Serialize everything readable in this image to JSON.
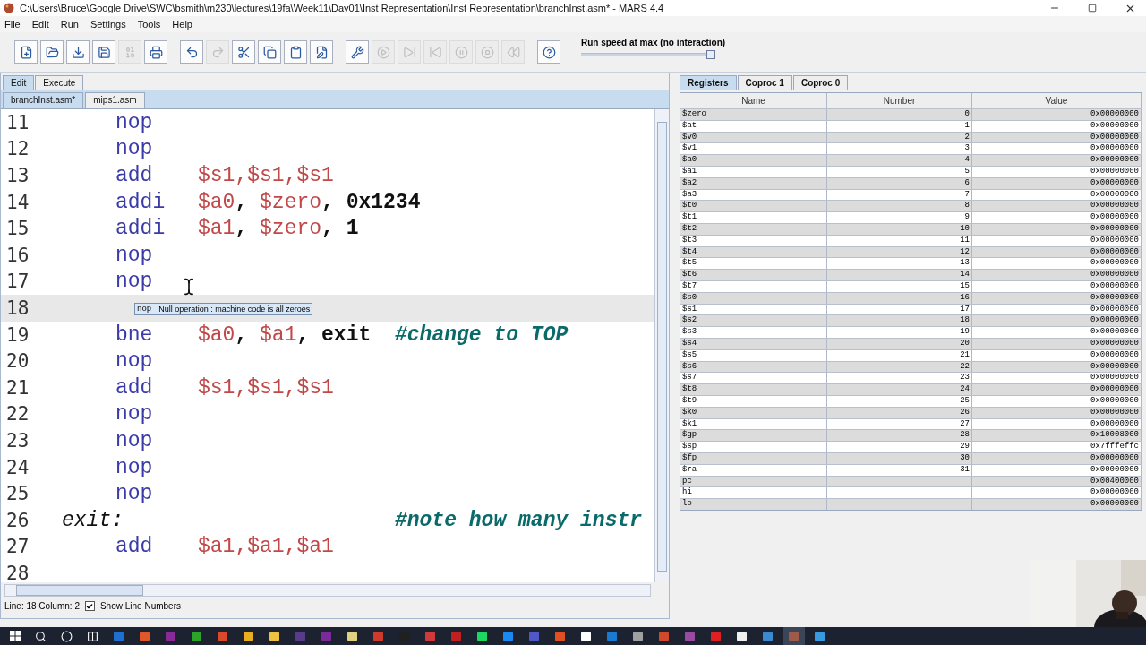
{
  "window": {
    "title": "C:\\Users\\Bruce\\Google Drive\\SWC\\bsmith\\m230\\lectures\\19fa\\Week11\\Day01\\Inst Representation\\Inst Representation\\branchInst.asm* - MARS 4.4"
  },
  "menu": [
    "File",
    "Edit",
    "Run",
    "Settings",
    "Tools",
    "Help"
  ],
  "toolbar": [
    {
      "kind": "new",
      "disabled": false
    },
    {
      "kind": "open",
      "disabled": false
    },
    {
      "kind": "save",
      "disabled": false
    },
    {
      "kind": "saveas",
      "disabled": false
    },
    {
      "kind": "dump",
      "disabled": true
    },
    {
      "kind": "print",
      "disabled": false
    },
    {
      "kind": "sep"
    },
    {
      "kind": "undo",
      "disabled": false
    },
    {
      "kind": "redo",
      "disabled": true
    },
    {
      "kind": "cut",
      "disabled": false
    },
    {
      "kind": "copy",
      "disabled": false
    },
    {
      "kind": "paste",
      "disabled": false
    },
    {
      "kind": "find",
      "disabled": false
    },
    {
      "kind": "sep"
    },
    {
      "kind": "assemble",
      "disabled": false
    },
    {
      "kind": "run",
      "disabled": true
    },
    {
      "kind": "step",
      "disabled": true
    },
    {
      "kind": "back",
      "disabled": true
    },
    {
      "kind": "pause",
      "disabled": true
    },
    {
      "kind": "stop",
      "disabled": true
    },
    {
      "kind": "reset",
      "disabled": true
    },
    {
      "kind": "sep"
    },
    {
      "kind": "help",
      "disabled": false
    }
  ],
  "speed": {
    "label": "Run speed at max (no interaction)",
    "level": 1
  },
  "mode_tabs": [
    {
      "label": "Edit",
      "selected": true
    },
    {
      "label": "Execute",
      "selected": false
    }
  ],
  "file_tabs": [
    {
      "label": "branchInst.asm*",
      "selected": true
    },
    {
      "label": "mips1.asm",
      "selected": false
    }
  ],
  "editor": {
    "lines": [
      {
        "number": "11",
        "op": "nop",
        "current": false
      },
      {
        "number": "12",
        "op": "nop",
        "current": false
      },
      {
        "number": "13",
        "op": "add",
        "args": [
          {
            "kind": "reg",
            "text": "$s1,$s1,$s1"
          }
        ],
        "current": false
      },
      {
        "number": "14",
        "op": "addi",
        "args": [
          {
            "kind": "reg",
            "text": "$a0"
          },
          {
            "kind": "punct",
            "text": ", "
          },
          {
            "kind": "reg",
            "text": "$zero"
          },
          {
            "kind": "punct",
            "text": ", "
          },
          {
            "kind": "imm",
            "text": "0x1234"
          }
        ],
        "current": false
      },
      {
        "number": "15",
        "op": "addi",
        "args": [
          {
            "kind": "reg",
            "text": "$a1"
          },
          {
            "kind": "punct",
            "text": ", "
          },
          {
            "kind": "reg",
            "text": "$zero"
          },
          {
            "kind": "punct",
            "text": ", "
          },
          {
            "kind": "imm",
            "text": "1"
          }
        ],
        "current": false
      },
      {
        "number": "16",
        "op": "nop",
        "current": false
      },
      {
        "number": "17",
        "op": "nop",
        "current": false
      },
      {
        "number": "18",
        "current": true
      },
      {
        "number": "19",
        "op": "bne",
        "args": [
          {
            "kind": "reg",
            "text": "$a0"
          },
          {
            "kind": "punct",
            "text": ", "
          },
          {
            "kind": "reg",
            "text": "$a1"
          },
          {
            "kind": "punct",
            "text": ", "
          },
          {
            "kind": "imm",
            "text": "exit"
          }
        ],
        "comment": "#change to TOP",
        "current": false
      },
      {
        "number": "20",
        "op": "nop",
        "current": false
      },
      {
        "number": "21",
        "op": "add",
        "args": [
          {
            "kind": "reg",
            "text": "$s1,$s1,$s1"
          }
        ],
        "current": false
      },
      {
        "number": "22",
        "op": "nop",
        "current": false
      },
      {
        "number": "23",
        "op": "nop",
        "current": false
      },
      {
        "number": "24",
        "op": "nop",
        "current": false
      },
      {
        "number": "25",
        "op": "nop",
        "current": false
      },
      {
        "number": "26",
        "label": "exit:",
        "comment": "#note how many instr",
        "current": false
      },
      {
        "number": "27",
        "op": "add",
        "args": [
          {
            "kind": "reg",
            "text": "$a1,$a1,$a1"
          }
        ],
        "current": false
      },
      {
        "number": "28",
        "current": false
      }
    ],
    "tooltip": {
      "mnemonic": "nop",
      "description": "Null operation : machine code is all zeroes"
    }
  },
  "status": {
    "position": "Line: 18 Column: 2",
    "show_line_numbers": {
      "label": "Show Line Numbers",
      "checked": true
    }
  },
  "register_tabs": [
    {
      "label": "Registers",
      "selected": true
    },
    {
      "label": "Coproc 1",
      "selected": false
    },
    {
      "label": "Coproc 0",
      "selected": false
    }
  ],
  "registers": {
    "columns": [
      "Name",
      "Number",
      "Value"
    ],
    "rows": [
      {
        "name": "$zero",
        "number": "0",
        "value": "0x00000000"
      },
      {
        "name": "$at",
        "number": "1",
        "value": "0x00000000"
      },
      {
        "name": "$v0",
        "number": "2",
        "value": "0x00000000"
      },
      {
        "name": "$v1",
        "number": "3",
        "value": "0x00000000"
      },
      {
        "name": "$a0",
        "number": "4",
        "value": "0x00000000"
      },
      {
        "name": "$a1",
        "number": "5",
        "value": "0x00000000"
      },
      {
        "name": "$a2",
        "number": "6",
        "value": "0x00000000"
      },
      {
        "name": "$a3",
        "number": "7",
        "value": "0x00000000"
      },
      {
        "name": "$t0",
        "number": "8",
        "value": "0x00000000"
      },
      {
        "name": "$t1",
        "number": "9",
        "value": "0x00000000"
      },
      {
        "name": "$t2",
        "number": "10",
        "value": "0x00000000"
      },
      {
        "name": "$t3",
        "number": "11",
        "value": "0x00000000"
      },
      {
        "name": "$t4",
        "number": "12",
        "value": "0x00000000"
      },
      {
        "name": "$t5",
        "number": "13",
        "value": "0x00000000"
      },
      {
        "name": "$t6",
        "number": "14",
        "value": "0x00000000"
      },
      {
        "name": "$t7",
        "number": "15",
        "value": "0x00000000"
      },
      {
        "name": "$s0",
        "number": "16",
        "value": "0x00000000"
      },
      {
        "name": "$s1",
        "number": "17",
        "value": "0x00000000"
      },
      {
        "name": "$s2",
        "number": "18",
        "value": "0x00000000"
      },
      {
        "name": "$s3",
        "number": "19",
        "value": "0x00000000"
      },
      {
        "name": "$s4",
        "number": "20",
        "value": "0x00000000"
      },
      {
        "name": "$s5",
        "number": "21",
        "value": "0x00000000"
      },
      {
        "name": "$s6",
        "number": "22",
        "value": "0x00000000"
      },
      {
        "name": "$s7",
        "number": "23",
        "value": "0x00000000"
      },
      {
        "name": "$t8",
        "number": "24",
        "value": "0x00000000"
      },
      {
        "name": "$t9",
        "number": "25",
        "value": "0x00000000"
      },
      {
        "name": "$k0",
        "number": "26",
        "value": "0x00000000"
      },
      {
        "name": "$k1",
        "number": "27",
        "value": "0x00000000"
      },
      {
        "name": "$gp",
        "number": "28",
        "value": "0x10008000"
      },
      {
        "name": "$sp",
        "number": "29",
        "value": "0x7fffeffc"
      },
      {
        "name": "$fp",
        "number": "30",
        "value": "0x00000000"
      },
      {
        "name": "$ra",
        "number": "31",
        "value": "0x00000000"
      },
      {
        "name": "pc",
        "value": "0x00400000"
      },
      {
        "name": "hi",
        "value": "0x00000000"
      },
      {
        "name": "lo",
        "value": "0x00000000"
      }
    ]
  },
  "taskbar": {
    "apps": [
      {
        "color": "#1e6fd0",
        "selected": false
      },
      {
        "color": "#e0582a",
        "selected": false
      },
      {
        "color": "#8a2a9a",
        "selected": false
      },
      {
        "color": "#2aa52a",
        "selected": false
      },
      {
        "color": "#d84a2a",
        "selected": false
      },
      {
        "color": "#e8b020",
        "selected": false
      },
      {
        "color": "#f0c040",
        "selected": false
      },
      {
        "color": "#5a3a8a",
        "selected": false
      },
      {
        "color": "#7a2a9a",
        "selected": false
      },
      {
        "color": "#e0d080",
        "selected": false
      },
      {
        "color": "#d03a2a",
        "selected": false
      },
      {
        "color": "#202020",
        "selected": false
      },
      {
        "color": "#d03a3a",
        "selected": false
      },
      {
        "color": "#c02020",
        "selected": false
      },
      {
        "color": "#1ed760",
        "selected": false
      },
      {
        "color": "#1a8af0",
        "selected": false
      },
      {
        "color": "#5058c8",
        "selected": false
      },
      {
        "color": "#e05020",
        "selected": false
      },
      {
        "color": "#ffffff",
        "selected": false
      },
      {
        "color": "#1a7ad0",
        "selected": false
      },
      {
        "color": "#a0a0a0",
        "selected": false
      },
      {
        "color": "#d04a2a",
        "selected": false
      },
      {
        "color": "#9a4aa0",
        "selected": false
      },
      {
        "color": "#e02020",
        "selected": false
      },
      {
        "color": "#f0f0f0",
        "selected": false
      },
      {
        "color": "#3a8ad0",
        "selected": false
      },
      {
        "color": "#a05a4a",
        "selected": true
      },
      {
        "color": "#3a9ae0",
        "selected": false
      }
    ]
  }
}
